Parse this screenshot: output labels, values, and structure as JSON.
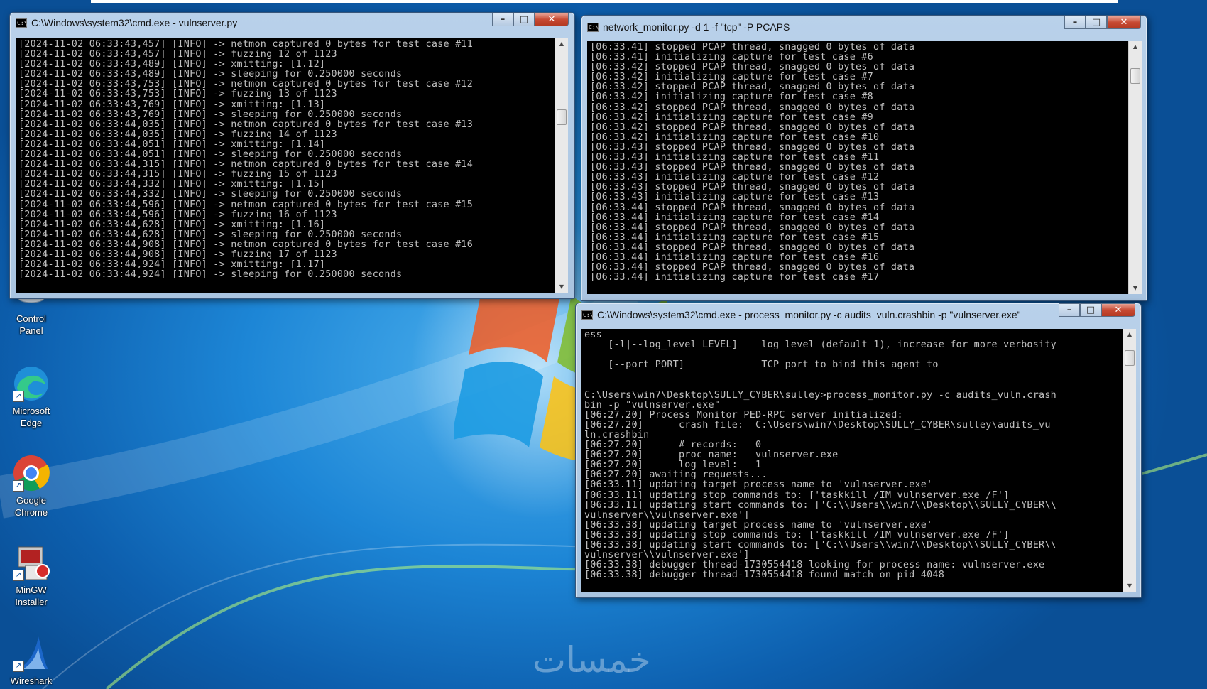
{
  "desktop": {
    "icons": [
      {
        "label_line1": "Control",
        "label_line2": "Panel",
        "icon": "control-panel-icon"
      },
      {
        "label_line1": "Microsoft",
        "label_line2": "Edge",
        "icon": "edge-icon"
      },
      {
        "label_line1": "Google",
        "label_line2": "Chrome",
        "icon": "chrome-icon"
      },
      {
        "label_line1": "MinGW",
        "label_line2": "Installer",
        "icon": "installer-icon"
      },
      {
        "label_line1": "Wireshark",
        "label_line2": "",
        "icon": "wireshark-icon"
      }
    ],
    "watermark": "خمسات"
  },
  "windows": {
    "vulnserver": {
      "title": "C:\\Windows\\system32\\cmd.exe - vulnserver.py",
      "lines": [
        "[2024-11-02 06:33:43,457] [INFO] -> netmon captured 0 bytes for test case #11",
        "[2024-11-02 06:33:43,457] [INFO] -> fuzzing 12 of 1123",
        "[2024-11-02 06:33:43,489] [INFO] -> xmitting: [1.12]",
        "[2024-11-02 06:33:43,489] [INFO] -> sleeping for 0.250000 seconds",
        "[2024-11-02 06:33:43,753] [INFO] -> netmon captured 0 bytes for test case #12",
        "[2024-11-02 06:33:43,753] [INFO] -> fuzzing 13 of 1123",
        "[2024-11-02 06:33:43,769] [INFO] -> xmitting: [1.13]",
        "[2024-11-02 06:33:43,769] [INFO] -> sleeping for 0.250000 seconds",
        "[2024-11-02 06:33:44,035] [INFO] -> netmon captured 0 bytes for test case #13",
        "[2024-11-02 06:33:44,035] [INFO] -> fuzzing 14 of 1123",
        "[2024-11-02 06:33:44,051] [INFO] -> xmitting: [1.14]",
        "[2024-11-02 06:33:44,051] [INFO] -> sleeping for 0.250000 seconds",
        "[2024-11-02 06:33:44,315] [INFO] -> netmon captured 0 bytes for test case #14",
        "[2024-11-02 06:33:44,315] [INFO] -> fuzzing 15 of 1123",
        "[2024-11-02 06:33:44,332] [INFO] -> xmitting: [1.15]",
        "[2024-11-02 06:33:44,332] [INFO] -> sleeping for 0.250000 seconds",
        "[2024-11-02 06:33:44,596] [INFO] -> netmon captured 0 bytes for test case #15",
        "[2024-11-02 06:33:44,596] [INFO] -> fuzzing 16 of 1123",
        "[2024-11-02 06:33:44,628] [INFO] -> xmitting: [1.16]",
        "[2024-11-02 06:33:44,628] [INFO] -> sleeping for 0.250000 seconds",
        "[2024-11-02 06:33:44,908] [INFO] -> netmon captured 0 bytes for test case #16",
        "[2024-11-02 06:33:44,908] [INFO] -> fuzzing 17 of 1123",
        "[2024-11-02 06:33:44,924] [INFO] -> xmitting: [1.17]",
        "[2024-11-02 06:33:44,924] [INFO] -> sleeping for 0.250000 seconds"
      ]
    },
    "network_monitor": {
      "title": "network_monitor.py  -d 1 -f \"tcp\" -P PCAPS",
      "lines": [
        "[06:33.41] stopped PCAP thread, snagged 0 bytes of data",
        "[06:33.41] initializing capture for test case #6",
        "[06:33.42] stopped PCAP thread, snagged 0 bytes of data",
        "[06:33.42] initializing capture for test case #7",
        "[06:33.42] stopped PCAP thread, snagged 0 bytes of data",
        "[06:33.42] initializing capture for test case #8",
        "[06:33.42] stopped PCAP thread, snagged 0 bytes of data",
        "[06:33.42] initializing capture for test case #9",
        "[06:33.42] stopped PCAP thread, snagged 0 bytes of data",
        "[06:33.42] initializing capture for test case #10",
        "[06:33.43] stopped PCAP thread, snagged 0 bytes of data",
        "[06:33.43] initializing capture for test case #11",
        "[06:33.43] stopped PCAP thread, snagged 0 bytes of data",
        "[06:33.43] initializing capture for test case #12",
        "[06:33.43] stopped PCAP thread, snagged 0 bytes of data",
        "[06:33.43] initializing capture for test case #13",
        "[06:33.44] stopped PCAP thread, snagged 0 bytes of data",
        "[06:33.44] initializing capture for test case #14",
        "[06:33.44] stopped PCAP thread, snagged 0 bytes of data",
        "[06:33.44] initializing capture for test case #15",
        "[06:33.44] stopped PCAP thread, snagged 0 bytes of data",
        "[06:33.44] initializing capture for test case #16",
        "[06:33.44] stopped PCAP thread, snagged 0 bytes of data",
        "[06:33.44] initializing capture for test case #17"
      ]
    },
    "process_monitor": {
      "title": "C:\\Windows\\system32\\cmd.exe - process_monitor.py  -c audits_vuln.crashbin -p \"vulnserver.exe\"",
      "lines": [
        "ess",
        "    [-l|--log_level LEVEL]    log level (default 1), increase for more verbosity",
        "",
        "    [--port PORT]             TCP port to bind this agent to",
        "",
        "",
        "C:\\Users\\win7\\Desktop\\SULLY_CYBER\\sulley>process_monitor.py -c audits_vuln.crash",
        "bin -p \"vulnserver.exe\"",
        "[06:27.20] Process Monitor PED-RPC server initialized:",
        "[06:27.20]      crash file:  C:\\Users\\win7\\Desktop\\SULLY_CYBER\\sulley\\audits_vu",
        "ln.crashbin",
        "[06:27.20]      # records:   0",
        "[06:27.20]      proc name:   vulnserver.exe",
        "[06:27.20]      log level:   1",
        "[06:27.20] awaiting requests...",
        "[06:33.11] updating target process name to 'vulnserver.exe'",
        "[06:33.11] updating stop commands to: ['taskkill /IM vulnserver.exe /F']",
        "[06:33.11] updating start commands to: ['C:\\\\Users\\\\win7\\\\Desktop\\\\SULLY_CYBER\\\\",
        "vulnserver\\\\vulnserver.exe']",
        "[06:33.38] updating target process name to 'vulnserver.exe'",
        "[06:33.38] updating stop commands to: ['taskkill /IM vulnserver.exe /F']",
        "[06:33.38] updating start commands to: ['C:\\\\Users\\\\win7\\\\Desktop\\\\SULLY_CYBER\\\\",
        "vulnserver\\\\vulnserver.exe']",
        "[06:33.38] debugger thread-1730554418 looking for process name: vulnserver.exe",
        "[06:33.38] debugger thread-1730554418 found match on pid 4048"
      ]
    }
  },
  "colors": {
    "console_bg": "#000000",
    "console_fg": "#c0c0c0",
    "close_button": "#c74a33",
    "frame": "#b9d1ea"
  }
}
